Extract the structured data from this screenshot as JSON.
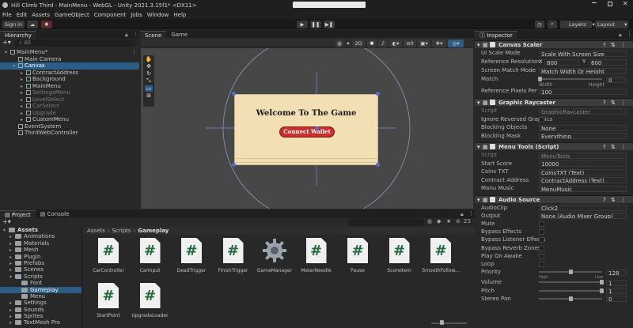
{
  "window": {
    "title": "Hill Climb Third - MainMenu - WebGL - Unity 2021.3.15f1* <DX11>"
  },
  "menu": [
    "File",
    "Edit",
    "Assets",
    "GameObject",
    "Component",
    "Jobs",
    "Window",
    "Help"
  ],
  "toolbar": {
    "sign_in": "Sign in",
    "layers": "Layers",
    "layout": "Layout"
  },
  "hierarchy": {
    "tab": "Hierarchy",
    "search": "All",
    "items": [
      {
        "label": "MainMenu*",
        "indent": 0,
        "state": "normal"
      },
      {
        "label": "Main Camera",
        "indent": 1,
        "state": "normal"
      },
      {
        "label": "Canvas",
        "indent": 1,
        "state": "selected"
      },
      {
        "label": "ContractAddress",
        "indent": 2,
        "state": "normal"
      },
      {
        "label": "Background",
        "indent": 2,
        "state": "normal"
      },
      {
        "label": "MainMenu",
        "indent": 2,
        "state": "normal"
      },
      {
        "label": "SettingsMenu",
        "indent": 2,
        "state": "dim"
      },
      {
        "label": "LevelSelect",
        "indent": 2,
        "state": "dim"
      },
      {
        "label": "CarSelect",
        "indent": 2,
        "state": "dim"
      },
      {
        "label": "Upgrade",
        "indent": 2,
        "state": "dim"
      },
      {
        "label": "CustomMenu",
        "indent": 2,
        "state": "normal"
      },
      {
        "label": "EventSystem",
        "indent": 1,
        "state": "normal"
      },
      {
        "label": "ThirdWebController",
        "indent": 1,
        "state": "normal"
      }
    ]
  },
  "scene": {
    "tab_scene": "Scene",
    "tab_game": "Game",
    "mode_2d": "2D",
    "welcome_text": "Welcome To The Game",
    "connect_button": "Connect Wallet"
  },
  "inspector": {
    "tab": "Inspector",
    "canvas_scaler": {
      "title": "Canvas Scaler",
      "rows": [
        {
          "label": "UI Scale Mode",
          "value": "Scale With Screen Size"
        },
        {
          "label": "Reference Resolution",
          "x_label": "X",
          "x": "800",
          "y_label": "Y",
          "y": "600"
        },
        {
          "label": "Screen Match Mode",
          "value": "Match Width Or Height"
        },
        {
          "label": "Match",
          "value": "0",
          "width_label": "Width",
          "height_label": "Height"
        },
        {
          "label": "Reference Pixels Per Unit",
          "value": "100"
        }
      ]
    },
    "graphic_raycaster": {
      "title": "Graphic Raycaster",
      "rows": [
        {
          "label": "Script",
          "value": "GraphicRaycaster"
        },
        {
          "label": "Ignore Reversed Graphics",
          "value": ""
        },
        {
          "label": "Blocking Objects",
          "value": "None"
        },
        {
          "label": "Blocking Mask",
          "value": "Everything"
        }
      ]
    },
    "menu_tools": {
      "title": "Menu Tools (Script)",
      "rows": [
        {
          "label": "Script",
          "value": "MenuTools"
        },
        {
          "label": "Start Score",
          "value": "10000"
        },
        {
          "label": "Coins TXT",
          "value": "CoinsTXT (Text)"
        },
        {
          "label": "Contract Address",
          "value": "ContractAddress (Text)"
        },
        {
          "label": "Manu Music",
          "value": "MenuMusic"
        }
      ]
    },
    "audio_source": {
      "title": "Audio Source",
      "rows": [
        {
          "label": "AudioClip",
          "value": "Click2"
        },
        {
          "label": "Output",
          "value": "None (Audio Mixer Group)"
        },
        {
          "label": "Mute",
          "value": ""
        },
        {
          "label": "Bypass Effects",
          "value": ""
        },
        {
          "label": "Bypass Listener Effects",
          "value": ""
        },
        {
          "label": "Bypass Reverb Zones",
          "value": ""
        },
        {
          "label": "Play On Awake",
          "value": ""
        },
        {
          "label": "Loop",
          "value": ""
        },
        {
          "label": "Priority",
          "value": "128",
          "high": "High",
          "low": "Low"
        },
        {
          "label": "Volume",
          "value": "1"
        },
        {
          "label": "Pitch",
          "value": "1"
        },
        {
          "label": "Stereo Pan",
          "value": "0"
        }
      ]
    }
  },
  "project": {
    "tab_project": "Project",
    "tab_console": "Console",
    "breadcrumb": [
      "Assets",
      "Scripts",
      "Gameplay"
    ],
    "tree": [
      {
        "label": "Assets",
        "indent": 0,
        "state": "bold"
      },
      {
        "label": "Animations",
        "indent": 1,
        "state": "normal"
      },
      {
        "label": "Materials",
        "indent": 1,
        "state": "normal"
      },
      {
        "label": "Mesh",
        "indent": 1,
        "state": "normal"
      },
      {
        "label": "Plugin",
        "indent": 1,
        "state": "normal"
      },
      {
        "label": "Prefabs",
        "indent": 1,
        "state": "normal"
      },
      {
        "label": "Scenes",
        "indent": 1,
        "state": "normal"
      },
      {
        "label": "Scripts",
        "indent": 1,
        "state": "normal"
      },
      {
        "label": "Font",
        "indent": 2,
        "state": "normal"
      },
      {
        "label": "Gameplay",
        "indent": 2,
        "state": "selected"
      },
      {
        "label": "Menu",
        "indent": 2,
        "state": "normal"
      },
      {
        "label": "Settings",
        "indent": 1,
        "state": "normal"
      },
      {
        "label": "Sounds",
        "indent": 1,
        "state": "normal"
      },
      {
        "label": "Sprites",
        "indent": 1,
        "state": "normal"
      },
      {
        "label": "TextMesh Pro",
        "indent": 1,
        "state": "normal"
      }
    ],
    "assets": [
      {
        "name": "CarController",
        "kind": "script"
      },
      {
        "name": "CarInput",
        "kind": "script"
      },
      {
        "name": "DeadTrigger",
        "kind": "script"
      },
      {
        "name": "FinishTrigger",
        "kind": "script"
      },
      {
        "name": "GameManager",
        "kind": "gear"
      },
      {
        "name": "MeterNeedle",
        "kind": "script"
      },
      {
        "name": "Pause",
        "kind": "script"
      },
      {
        "name": "ScoreItem",
        "kind": "script"
      },
      {
        "name": "SmoothFollow...",
        "kind": "script"
      },
      {
        "name": "StartPoint",
        "kind": "script"
      },
      {
        "name": "UpgradeLoader",
        "kind": "script"
      }
    ],
    "count_badge": "23"
  },
  "colors": {
    "selection": "#2c5d87",
    "panel": "#282828",
    "header": "#1f1f1f",
    "button_red": "#c8302c",
    "game_bg": "#f3dfb4"
  }
}
